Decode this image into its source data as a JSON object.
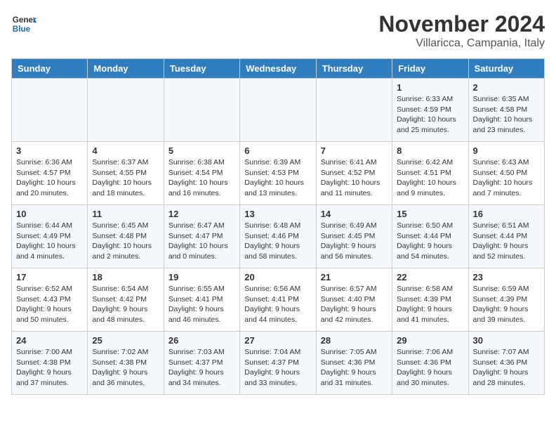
{
  "header": {
    "logo_general": "General",
    "logo_blue": "Blue",
    "month_title": "November 2024",
    "location": "Villaricca, Campania, Italy"
  },
  "weekdays": [
    "Sunday",
    "Monday",
    "Tuesday",
    "Wednesday",
    "Thursday",
    "Friday",
    "Saturday"
  ],
  "weeks": [
    [
      {
        "day": "",
        "info": ""
      },
      {
        "day": "",
        "info": ""
      },
      {
        "day": "",
        "info": ""
      },
      {
        "day": "",
        "info": ""
      },
      {
        "day": "",
        "info": ""
      },
      {
        "day": "1",
        "info": "Sunrise: 6:33 AM\nSunset: 4:59 PM\nDaylight: 10 hours and 25 minutes."
      },
      {
        "day": "2",
        "info": "Sunrise: 6:35 AM\nSunset: 4:58 PM\nDaylight: 10 hours and 23 minutes."
      }
    ],
    [
      {
        "day": "3",
        "info": "Sunrise: 6:36 AM\nSunset: 4:57 PM\nDaylight: 10 hours and 20 minutes."
      },
      {
        "day": "4",
        "info": "Sunrise: 6:37 AM\nSunset: 4:55 PM\nDaylight: 10 hours and 18 minutes."
      },
      {
        "day": "5",
        "info": "Sunrise: 6:38 AM\nSunset: 4:54 PM\nDaylight: 10 hours and 16 minutes."
      },
      {
        "day": "6",
        "info": "Sunrise: 6:39 AM\nSunset: 4:53 PM\nDaylight: 10 hours and 13 minutes."
      },
      {
        "day": "7",
        "info": "Sunrise: 6:41 AM\nSunset: 4:52 PM\nDaylight: 10 hours and 11 minutes."
      },
      {
        "day": "8",
        "info": "Sunrise: 6:42 AM\nSunset: 4:51 PM\nDaylight: 10 hours and 9 minutes."
      },
      {
        "day": "9",
        "info": "Sunrise: 6:43 AM\nSunset: 4:50 PM\nDaylight: 10 hours and 7 minutes."
      }
    ],
    [
      {
        "day": "10",
        "info": "Sunrise: 6:44 AM\nSunset: 4:49 PM\nDaylight: 10 hours and 4 minutes."
      },
      {
        "day": "11",
        "info": "Sunrise: 6:45 AM\nSunset: 4:48 PM\nDaylight: 10 hours and 2 minutes."
      },
      {
        "day": "12",
        "info": "Sunrise: 6:47 AM\nSunset: 4:47 PM\nDaylight: 10 hours and 0 minutes."
      },
      {
        "day": "13",
        "info": "Sunrise: 6:48 AM\nSunset: 4:46 PM\nDaylight: 9 hours and 58 minutes."
      },
      {
        "day": "14",
        "info": "Sunrise: 6:49 AM\nSunset: 4:45 PM\nDaylight: 9 hours and 56 minutes."
      },
      {
        "day": "15",
        "info": "Sunrise: 6:50 AM\nSunset: 4:44 PM\nDaylight: 9 hours and 54 minutes."
      },
      {
        "day": "16",
        "info": "Sunrise: 6:51 AM\nSunset: 4:44 PM\nDaylight: 9 hours and 52 minutes."
      }
    ],
    [
      {
        "day": "17",
        "info": "Sunrise: 6:52 AM\nSunset: 4:43 PM\nDaylight: 9 hours and 50 minutes."
      },
      {
        "day": "18",
        "info": "Sunrise: 6:54 AM\nSunset: 4:42 PM\nDaylight: 9 hours and 48 minutes."
      },
      {
        "day": "19",
        "info": "Sunrise: 6:55 AM\nSunset: 4:41 PM\nDaylight: 9 hours and 46 minutes."
      },
      {
        "day": "20",
        "info": "Sunrise: 6:56 AM\nSunset: 4:41 PM\nDaylight: 9 hours and 44 minutes."
      },
      {
        "day": "21",
        "info": "Sunrise: 6:57 AM\nSunset: 4:40 PM\nDaylight: 9 hours and 42 minutes."
      },
      {
        "day": "22",
        "info": "Sunrise: 6:58 AM\nSunset: 4:39 PM\nDaylight: 9 hours and 41 minutes."
      },
      {
        "day": "23",
        "info": "Sunrise: 6:59 AM\nSunset: 4:39 PM\nDaylight: 9 hours and 39 minutes."
      }
    ],
    [
      {
        "day": "24",
        "info": "Sunrise: 7:00 AM\nSunset: 4:38 PM\nDaylight: 9 hours and 37 minutes."
      },
      {
        "day": "25",
        "info": "Sunrise: 7:02 AM\nSunset: 4:38 PM\nDaylight: 9 hours and 36 minutes."
      },
      {
        "day": "26",
        "info": "Sunrise: 7:03 AM\nSunset: 4:37 PM\nDaylight: 9 hours and 34 minutes."
      },
      {
        "day": "27",
        "info": "Sunrise: 7:04 AM\nSunset: 4:37 PM\nDaylight: 9 hours and 33 minutes."
      },
      {
        "day": "28",
        "info": "Sunrise: 7:05 AM\nSunset: 4:36 PM\nDaylight: 9 hours and 31 minutes."
      },
      {
        "day": "29",
        "info": "Sunrise: 7:06 AM\nSunset: 4:36 PM\nDaylight: 9 hours and 30 minutes."
      },
      {
        "day": "30",
        "info": "Sunrise: 7:07 AM\nSunset: 4:36 PM\nDaylight: 9 hours and 28 minutes."
      }
    ]
  ]
}
